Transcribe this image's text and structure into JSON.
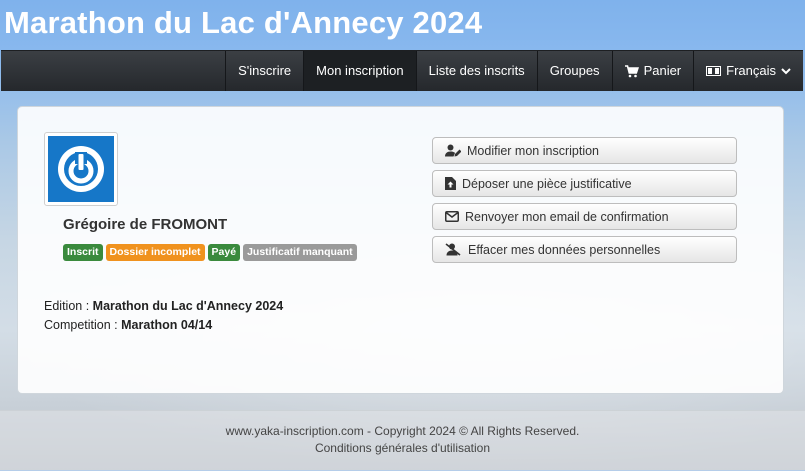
{
  "header": {
    "title": "Marathon du Lac d'Annecy 2024"
  },
  "nav": {
    "items": [
      {
        "label": "S'inscrire"
      },
      {
        "label": "Mon inscription"
      },
      {
        "label": "Liste des inscrits"
      },
      {
        "label": "Groupes"
      },
      {
        "label": "Panier",
        "icon": "cart-icon"
      },
      {
        "label": "Français",
        "icon": "flag-icon"
      }
    ]
  },
  "profile": {
    "name": "Grégoire de FROMONT",
    "badges": [
      {
        "label": "Inscrit",
        "color": "#3a8a3d"
      },
      {
        "label": "Dossier incomplet",
        "color": "#f0921e"
      },
      {
        "label": "Payé",
        "color": "#3a8a3d"
      },
      {
        "label": "Justificatif manquant",
        "color": "#9a9a9a"
      }
    ]
  },
  "info": {
    "edition_label": "Edition :",
    "edition_value": "Marathon du Lac d'Annecy 2024",
    "competition_label": "Competition :",
    "competition_value": "Marathon 04/14"
  },
  "actions": [
    {
      "label": "Modifier mon inscription",
      "icon": "user-edit-icon"
    },
    {
      "label": "Déposer une pièce justificative",
      "icon": "file-upload-icon"
    },
    {
      "label": "Renvoyer mon email de confirmation",
      "icon": "envelope-icon"
    },
    {
      "label": "Effacer mes données personnelles",
      "icon": "user-remove-icon"
    }
  ],
  "footer": {
    "copyright": "www.yaka-inscription.com - Copyright 2024 © All Rights Reserved.",
    "terms": "Conditions générales d'utilisation"
  },
  "colors": {
    "navbar": "#2c2f33",
    "accent": "#1677c8"
  }
}
